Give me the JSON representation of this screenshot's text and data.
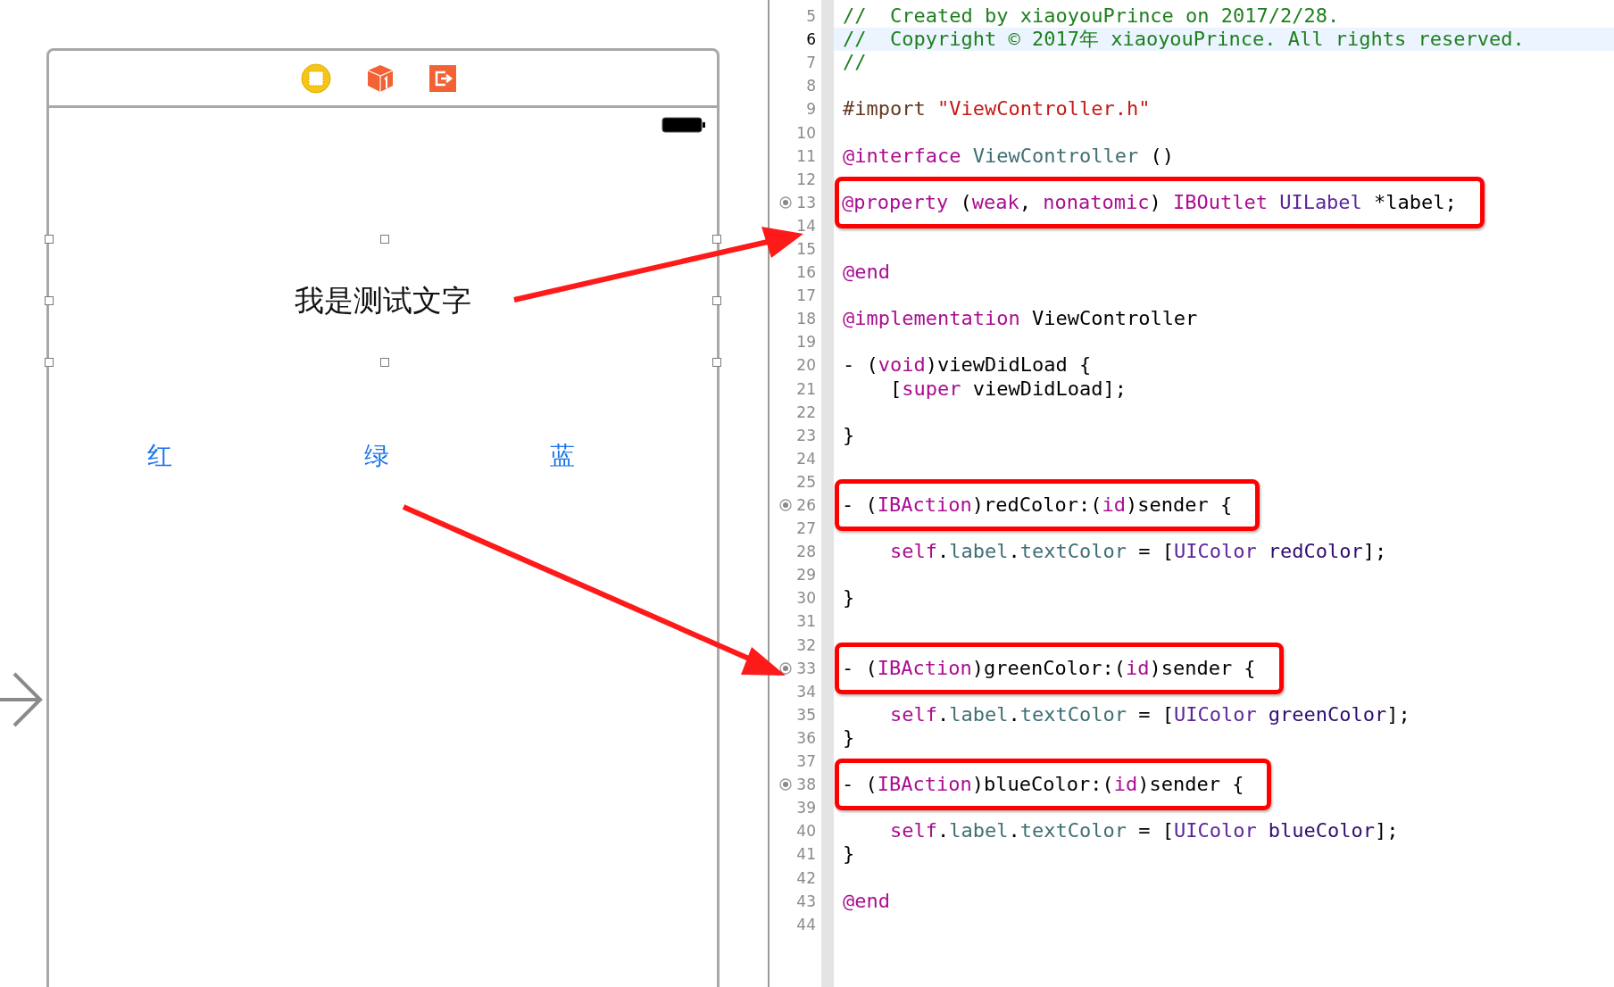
{
  "storyboard": {
    "label": "我是测试文字",
    "buttons": [
      {
        "text": "红"
      },
      {
        "text": "绿"
      },
      {
        "text": "蓝"
      }
    ]
  },
  "editor": {
    "lines": [
      {
        "number": "5",
        "current": false,
        "connected": false,
        "boxed": false,
        "tokens": [
          {
            "kind": "comment",
            "text": "//  Created by xiaoyouPrince on 2017/2/28."
          }
        ]
      },
      {
        "number": "6",
        "current": true,
        "connected": false,
        "boxed": false,
        "tokens": [
          {
            "kind": "comment",
            "text": "//  Copyright © 2017年 xiaoyouPrince. All rights reserved."
          }
        ]
      },
      {
        "number": "7",
        "current": false,
        "connected": false,
        "boxed": false,
        "tokens": [
          {
            "kind": "comment",
            "text": "//"
          }
        ]
      },
      {
        "number": "8",
        "current": false,
        "connected": false,
        "boxed": false
      },
      {
        "number": "9",
        "current": false,
        "connected": false,
        "boxed": false,
        "tokens": [
          {
            "kind": "preprocessor",
            "text": "#import "
          },
          {
            "kind": "string",
            "text": "\"ViewController.h\""
          }
        ]
      },
      {
        "number": "10",
        "current": false,
        "connected": false,
        "boxed": false
      },
      {
        "number": "11",
        "current": false,
        "connected": false,
        "boxed": false,
        "tokens": [
          {
            "kind": "keyword",
            "text": "@interface "
          },
          {
            "kind": "class",
            "text": "ViewController"
          },
          {
            "kind": "plain",
            "text": " ()"
          }
        ]
      },
      {
        "number": "12",
        "current": false,
        "connected": false,
        "boxed": false
      },
      {
        "number": "13",
        "current": false,
        "connected": true,
        "boxed": true,
        "tokens": [
          {
            "kind": "keyword",
            "text": "@property"
          },
          {
            "kind": "plain",
            "text": " ("
          },
          {
            "kind": "keyword",
            "text": "weak"
          },
          {
            "kind": "plain",
            "text": ", "
          },
          {
            "kind": "keyword",
            "text": "nonatomic"
          },
          {
            "kind": "plain",
            "text": ") "
          },
          {
            "kind": "keyword",
            "text": "IBOutlet "
          },
          {
            "kind": "type",
            "text": "UILabel"
          },
          {
            "kind": "plain",
            "text": " *label;"
          }
        ]
      },
      {
        "number": "14",
        "current": false,
        "connected": false,
        "boxed": false
      },
      {
        "number": "15",
        "current": false,
        "connected": false,
        "boxed": false
      },
      {
        "number": "16",
        "current": false,
        "connected": false,
        "boxed": false,
        "tokens": [
          {
            "kind": "keyword",
            "text": "@end"
          }
        ]
      },
      {
        "number": "17",
        "current": false,
        "connected": false,
        "boxed": false
      },
      {
        "number": "18",
        "current": false,
        "connected": false,
        "boxed": false,
        "tokens": [
          {
            "kind": "keyword",
            "text": "@implementation"
          },
          {
            "kind": "plain",
            "text": " ViewController"
          }
        ]
      },
      {
        "number": "19",
        "current": false,
        "connected": false,
        "boxed": false
      },
      {
        "number": "20",
        "current": false,
        "connected": false,
        "boxed": false,
        "tokens": [
          {
            "kind": "plain",
            "text": "- ("
          },
          {
            "kind": "keyword",
            "text": "void"
          },
          {
            "kind": "plain",
            "text": ")viewDidLoad {"
          }
        ]
      },
      {
        "number": "21",
        "current": false,
        "connected": false,
        "boxed": false,
        "tokens": [
          {
            "kind": "plain",
            "text": "    ["
          },
          {
            "kind": "keyword",
            "text": "super"
          },
          {
            "kind": "plain",
            "text": " viewDidLoad];"
          }
        ]
      },
      {
        "number": "22",
        "current": false,
        "connected": false,
        "boxed": false
      },
      {
        "number": "23",
        "current": false,
        "connected": false,
        "boxed": false,
        "tokens": [
          {
            "kind": "plain",
            "text": "}"
          }
        ]
      },
      {
        "number": "24",
        "current": false,
        "connected": false,
        "boxed": false
      },
      {
        "number": "25",
        "current": false,
        "connected": false,
        "boxed": false
      },
      {
        "number": "26",
        "current": false,
        "connected": true,
        "boxed": true,
        "tokens": [
          {
            "kind": "plain",
            "text": "- ("
          },
          {
            "kind": "keyword",
            "text": "IBAction"
          },
          {
            "kind": "plain",
            "text": ")redColor:("
          },
          {
            "kind": "keyword",
            "text": "id"
          },
          {
            "kind": "plain",
            "text": ")sender {"
          }
        ]
      },
      {
        "number": "27",
        "current": false,
        "connected": false,
        "boxed": false
      },
      {
        "number": "28",
        "current": false,
        "connected": false,
        "boxed": false,
        "tokens": [
          {
            "kind": "keyword",
            "text": "    self"
          },
          {
            "kind": "plain",
            "text": "."
          },
          {
            "kind": "member",
            "text": "label"
          },
          {
            "kind": "plain",
            "text": "."
          },
          {
            "kind": "member",
            "text": "textColor"
          },
          {
            "kind": "plain",
            "text": " = ["
          },
          {
            "kind": "type",
            "text": "UIColor"
          },
          {
            "kind": "sysmethod",
            "text": " redColor"
          },
          {
            "kind": "plain",
            "text": "];"
          }
        ]
      },
      {
        "number": "29",
        "current": false,
        "connected": false,
        "boxed": false
      },
      {
        "number": "30",
        "current": false,
        "connected": false,
        "boxed": false,
        "tokens": [
          {
            "kind": "plain",
            "text": "}"
          }
        ]
      },
      {
        "number": "31",
        "current": false,
        "connected": false,
        "boxed": false
      },
      {
        "number": "32",
        "current": false,
        "connected": false,
        "boxed": false
      },
      {
        "number": "33",
        "current": false,
        "connected": true,
        "boxed": true,
        "tokens": [
          {
            "kind": "plain",
            "text": "- ("
          },
          {
            "kind": "keyword",
            "text": "IBAction"
          },
          {
            "kind": "plain",
            "text": ")greenColor:("
          },
          {
            "kind": "keyword",
            "text": "id"
          },
          {
            "kind": "plain",
            "text": ")sender {"
          }
        ]
      },
      {
        "number": "34",
        "current": false,
        "connected": false,
        "boxed": false
      },
      {
        "number": "35",
        "current": false,
        "connected": false,
        "boxed": false,
        "tokens": [
          {
            "kind": "keyword",
            "text": "    self"
          },
          {
            "kind": "plain",
            "text": "."
          },
          {
            "kind": "member",
            "text": "label"
          },
          {
            "kind": "plain",
            "text": "."
          },
          {
            "kind": "member",
            "text": "textColor"
          },
          {
            "kind": "plain",
            "text": " = ["
          },
          {
            "kind": "type",
            "text": "UIColor"
          },
          {
            "kind": "sysmethod",
            "text": " greenColor"
          },
          {
            "kind": "plain",
            "text": "];"
          }
        ]
      },
      {
        "number": "36",
        "current": false,
        "connected": false,
        "boxed": false,
        "tokens": [
          {
            "kind": "plain",
            "text": "}"
          }
        ]
      },
      {
        "number": "37",
        "current": false,
        "connected": false,
        "boxed": false
      },
      {
        "number": "38",
        "current": false,
        "connected": true,
        "boxed": true,
        "tokens": [
          {
            "kind": "plain",
            "text": "- ("
          },
          {
            "kind": "keyword",
            "text": "IBAction"
          },
          {
            "kind": "plain",
            "text": ")blueColor:("
          },
          {
            "kind": "keyword",
            "text": "id"
          },
          {
            "kind": "plain",
            "text": ")sender {"
          }
        ]
      },
      {
        "number": "39",
        "current": false,
        "connected": false,
        "boxed": false
      },
      {
        "number": "40",
        "current": false,
        "connected": false,
        "boxed": false,
        "tokens": [
          {
            "kind": "keyword",
            "text": "    self"
          },
          {
            "kind": "plain",
            "text": "."
          },
          {
            "kind": "member",
            "text": "label"
          },
          {
            "kind": "plain",
            "text": "."
          },
          {
            "kind": "member",
            "text": "textColor"
          },
          {
            "kind": "plain",
            "text": " = ["
          },
          {
            "kind": "type",
            "text": "UIColor"
          },
          {
            "kind": "sysmethod",
            "text": " blueColor"
          },
          {
            "kind": "plain",
            "text": "];"
          }
        ]
      },
      {
        "number": "41",
        "current": false,
        "connected": false,
        "boxed": false,
        "tokens": [
          {
            "kind": "plain",
            "text": "}"
          }
        ]
      },
      {
        "number": "42",
        "current": false,
        "connected": false,
        "boxed": false
      },
      {
        "number": "43",
        "current": false,
        "connected": false,
        "boxed": false,
        "tokens": [
          {
            "kind": "keyword",
            "text": "@end"
          }
        ]
      },
      {
        "number": "44",
        "current": false,
        "connected": false,
        "boxed": false
      }
    ]
  }
}
